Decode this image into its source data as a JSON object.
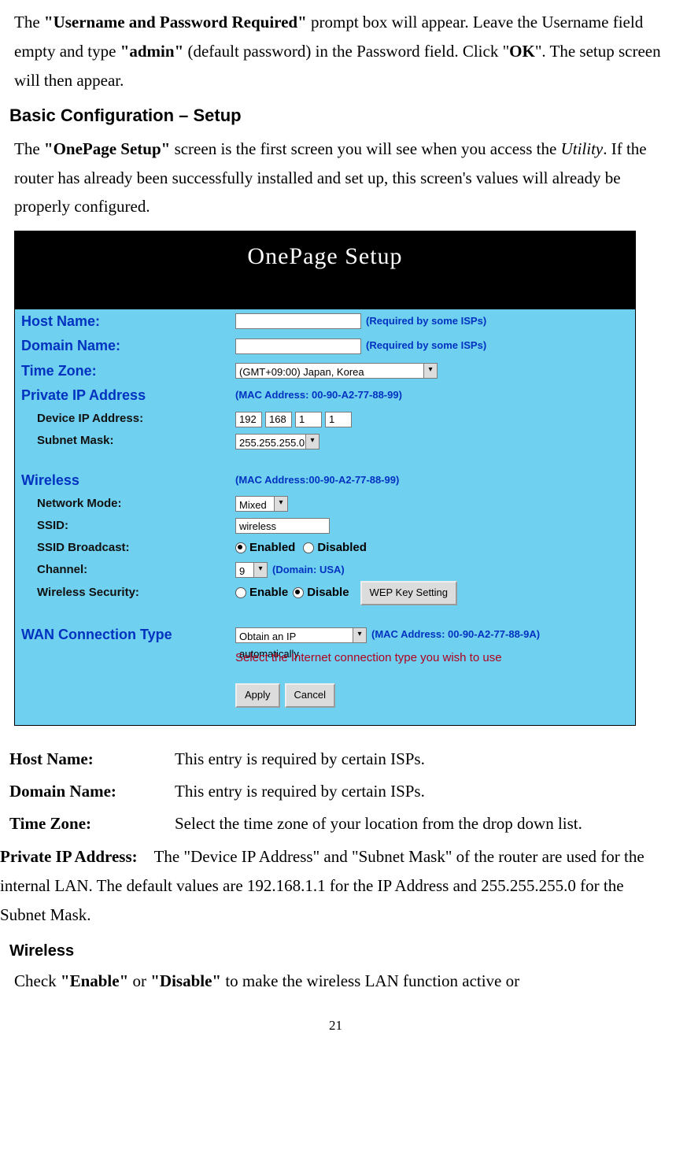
{
  "intro": {
    "p1_a": "The ",
    "p1_b": "\"Username and Password Required\"",
    "p1_c": " prompt box will appear. Leave the Username field empty and type ",
    "p1_d": "\"admin\"",
    "p1_e": " (default password) in the Password field. Click \"",
    "p1_f": "OK",
    "p1_g": "\". The setup screen will then appear."
  },
  "section1_title": "Basic Configuration – Setup",
  "intro2": {
    "a": "The ",
    "b": "\"OnePage Setup\"",
    "c": " screen is the first screen you will see when you access the ",
    "d": "Utility",
    "e": ". If the router has already been successfully installed and set up, this screen's values will already be properly configured."
  },
  "ss": {
    "title": "OnePage Setup",
    "hostname_label": "Host Name:",
    "domainname_label": "Domain Name:",
    "timezone_label": "Time Zone:",
    "private_ip_header": "Private IP Address",
    "device_ip_label": "Device IP Address:",
    "subnet_label": "Subnet Mask:",
    "wireless_header": "Wireless",
    "netmode_label": "Network Mode:",
    "ssid_label": "SSID:",
    "ssidb_label": "SSID Broadcast:",
    "channel_label": "Channel:",
    "wsec_label": "Wireless Security:",
    "wan_header": "WAN Connection Type",
    "req_note": "(Required by some ISPs)",
    "mac_private": "(MAC Address: 00-90-A2-77-88-99)",
    "mac_wireless": "(MAC Address:00-90-A2-77-88-99)",
    "mac_wan": "(MAC Address: 00-90-A2-77-88-9A)",
    "tz_value": "(GMT+09:00) Japan, Korea",
    "ip": {
      "a": "192",
      "b": "168",
      "c": "1",
      "d": "1"
    },
    "subnet_value": "255.255.255.0",
    "netmode_value": "Mixed",
    "ssid_value": "wireless",
    "enabled": "Enabled",
    "disabled": "Disabled",
    "channel_value": "9",
    "channel_domain": "(Domain: USA)",
    "enable": "Enable",
    "disable": "Disable",
    "wep_btn": "WEP Key Setting",
    "wan_value": "Obtain an IP automatically",
    "red_instr": "Select the Internet connection type you wish to use",
    "apply": "Apply",
    "cancel": "Cancel"
  },
  "def": {
    "host_t": "Host Name:",
    "host_d": "This entry is required by certain ISPs.",
    "dom_t": "Domain Name:",
    "dom_d": "This entry is required by certain ISPs.",
    "tz_t": "Time Zone:",
    "tz_d": "Select the time zone of your location from the drop down list.",
    "pip_t": "Private IP Address:",
    "pip_d": "The \"Device IP Address\" and \"Subnet Mask\" of the router are used for the internal LAN. The default values are 192.168.1.1 for the IP Address and 255.255.255.0 for the Subnet Mask."
  },
  "wireless_heading": "Wireless",
  "wireless_p": {
    "a": "Check ",
    "b": "\"Enable\"",
    "c": " or ",
    "d": "\"Disable\"",
    "e": " to make the wireless LAN function active or"
  },
  "pagenum": "21"
}
